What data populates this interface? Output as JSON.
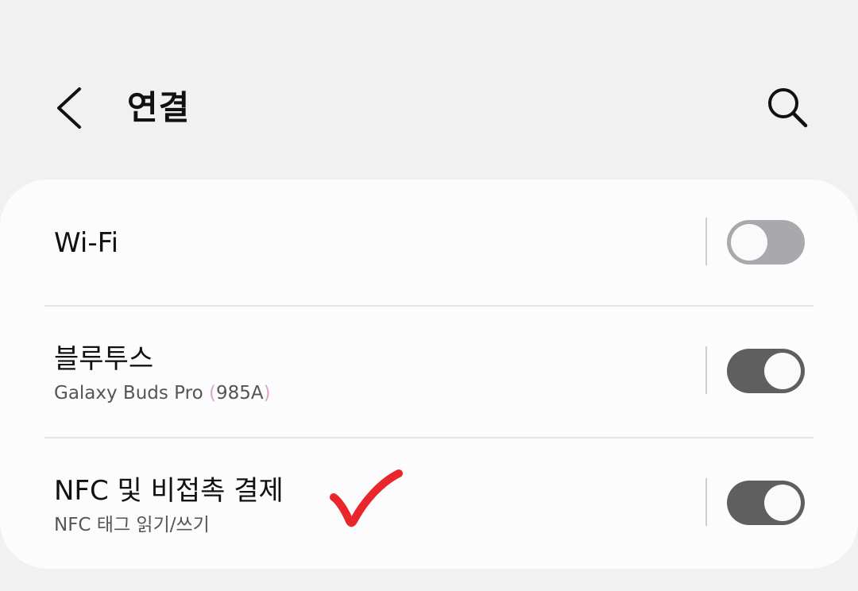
{
  "header": {
    "title": "연결",
    "back_icon": "chevron-left-icon",
    "search_icon": "search-icon"
  },
  "settings": {
    "wifi": {
      "title": "Wi-Fi",
      "enabled": false
    },
    "bluetooth": {
      "title": "블루투스",
      "subtitle_main": "Galaxy Buds Pro ",
      "subtitle_paren_open": "(",
      "subtitle_code": "985A",
      "subtitle_paren_close": ")",
      "enabled": true
    },
    "nfc": {
      "title": "NFC 및 비접촉 결제",
      "subtitle": "NFC 태그 읽기/쓰기",
      "enabled": true
    }
  },
  "annotation": {
    "icon": "red-checkmark-icon",
    "color": "#e8262b"
  },
  "colors": {
    "background": "#f1f1f1",
    "card": "#fcfcfc",
    "toggle_on": "#5f5f5f",
    "toggle_off": "#a9a8ad"
  }
}
